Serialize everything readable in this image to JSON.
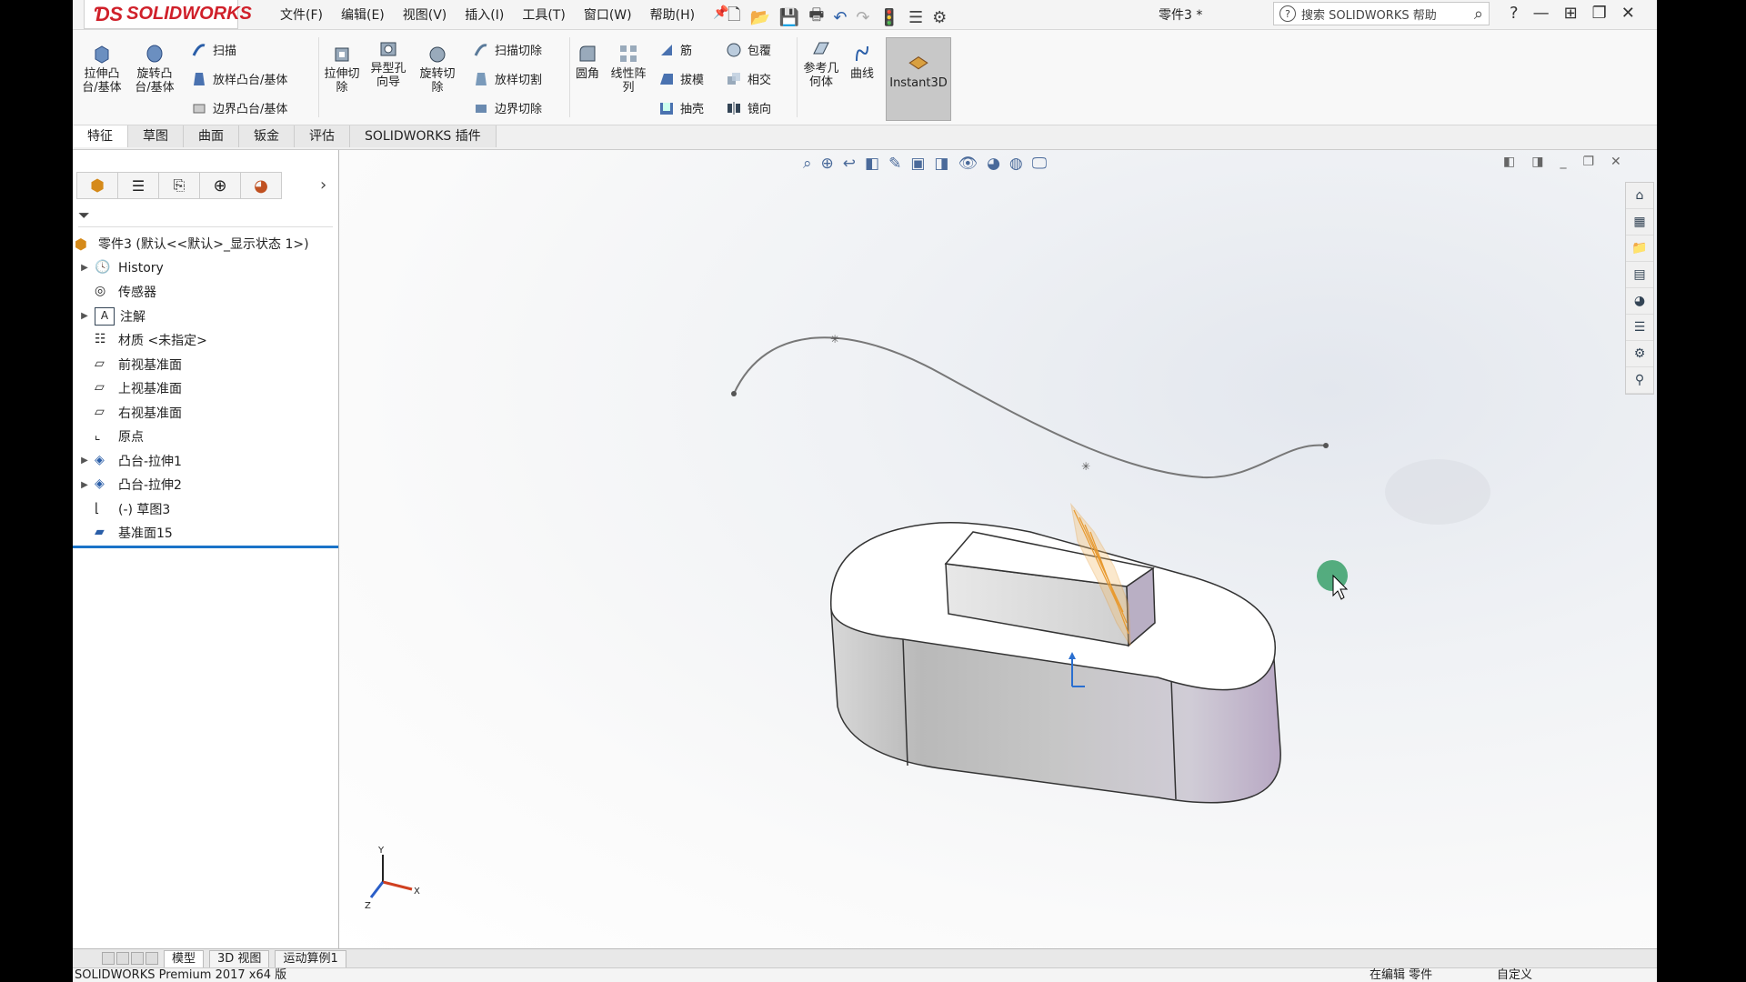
{
  "app": {
    "brand": "SOLIDWORKS",
    "doc_title": "零件3 *"
  },
  "menus": [
    "文件(F)",
    "编辑(E)",
    "视图(V)",
    "插入(I)",
    "工具(T)",
    "窗口(W)",
    "帮助(H)"
  ],
  "help_search": {
    "placeholder": "搜索 SOLIDWORKS 帮助"
  },
  "ribbon": {
    "extrude_boss": "拉伸凸台/基体",
    "revolve_boss": "旋转凸台/基体",
    "sweep": "扫描",
    "loft_boss": "放样凸台/基体",
    "boundary_boss": "边界凸台/基体",
    "extrude_cut": "拉伸切除",
    "hole_wizard": "异型孔向导",
    "revolve_cut": "旋转切除",
    "swept_cut": "扫描切除",
    "loft_cut": "放样切割",
    "boundary_cut": "边界切除",
    "fillet": "圆角",
    "linear_pattern": "线性阵列",
    "rib": "筋",
    "draft": "拔模",
    "shell": "抽壳",
    "wrap": "包覆",
    "intersect": "相交",
    "mirror": "镜向",
    "ref_geometry": "参考几何体",
    "curves": "曲线",
    "instant3d": "Instant3D"
  },
  "tabs": [
    "特征",
    "草图",
    "曲面",
    "钣金",
    "评估",
    "SOLIDWORKS 插件"
  ],
  "tree": {
    "root": "零件3  (默认<<默认>_显示状态 1>)",
    "items": [
      {
        "label": "History",
        "expand": true,
        "icon": "history-icon"
      },
      {
        "label": "传感器",
        "expand": false,
        "icon": "sensor-icon"
      },
      {
        "label": "注解",
        "expand": true,
        "icon": "annotation-icon"
      },
      {
        "label": "材质 <未指定>",
        "expand": false,
        "icon": "material-icon"
      },
      {
        "label": "前视基准面",
        "expand": false,
        "icon": "plane-icon"
      },
      {
        "label": "上视基准面",
        "expand": false,
        "icon": "plane-icon"
      },
      {
        "label": "右视基准面",
        "expand": false,
        "icon": "plane-icon"
      },
      {
        "label": "原点",
        "expand": false,
        "icon": "origin-icon"
      },
      {
        "label": "凸台-拉伸1",
        "expand": true,
        "icon": "extrude-icon"
      },
      {
        "label": "凸台-拉伸2",
        "expand": true,
        "icon": "extrude-icon"
      },
      {
        "label": "(-) 草图3",
        "expand": false,
        "icon": "sketch-icon"
      },
      {
        "label": "基准面15",
        "expand": false,
        "icon": "plane-icon"
      }
    ]
  },
  "triad": {
    "y": "Y",
    "x": "X",
    "z": "Z"
  },
  "bottom_tabs": [
    "模型",
    "3D 视图",
    "运动算例1"
  ],
  "status": {
    "product": "SOLIDWORKS Premium 2017 x64 版",
    "editing": "在编辑 零件",
    "units": "自定义"
  },
  "colors": {
    "accent": "#1a73c8",
    "brand": "#d0202a",
    "instant_bg": "#c8c8c8",
    "cursor_dot": "#3aa06a"
  }
}
